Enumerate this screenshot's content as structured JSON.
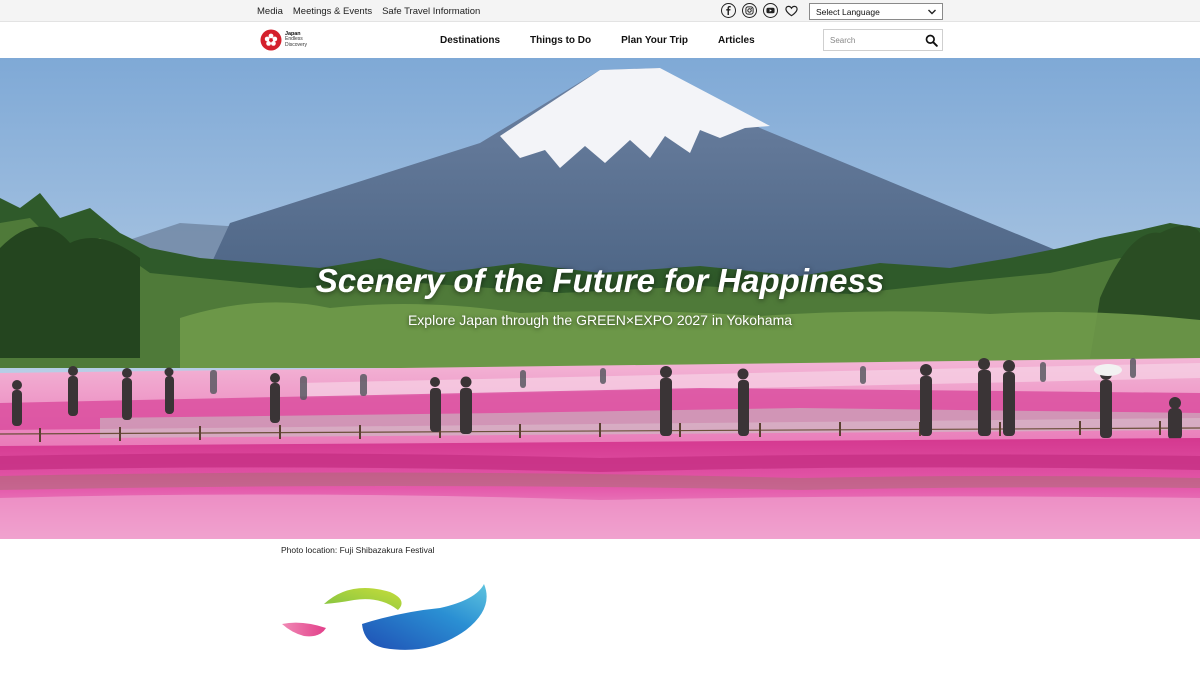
{
  "utility_bar": {
    "links": [
      "Media",
      "Meetings & Events",
      "Safe Travel Information"
    ],
    "social_icons": [
      "facebook-icon",
      "instagram-icon",
      "youtube-icon",
      "heart-icon"
    ],
    "language_select": {
      "selected": "Select Language"
    }
  },
  "header": {
    "logo": {
      "line1": "Japan",
      "line2": "Endless",
      "line3": "Discovery"
    },
    "nav": [
      "Destinations",
      "Things to Do",
      "Plan Your Trip",
      "Articles"
    ],
    "search": {
      "placeholder": "Search",
      "value": ""
    }
  },
  "hero": {
    "title": "Scenery of the Future for Happiness",
    "subtitle": "Explore Japan through the GREEN×EXPO 2027 in Yokohama"
  },
  "caption": "Photo location: Fuji Shibazakura Festival",
  "colors": {
    "sky_top": "#7fa9d6",
    "sky_bottom": "#d4e1ee",
    "mountain": "#5c7494",
    "snow": "#f3f4f8",
    "forest": "#2f5a2a",
    "flower_pink": "#e1479f",
    "flower_light": "#f2a3d0"
  }
}
